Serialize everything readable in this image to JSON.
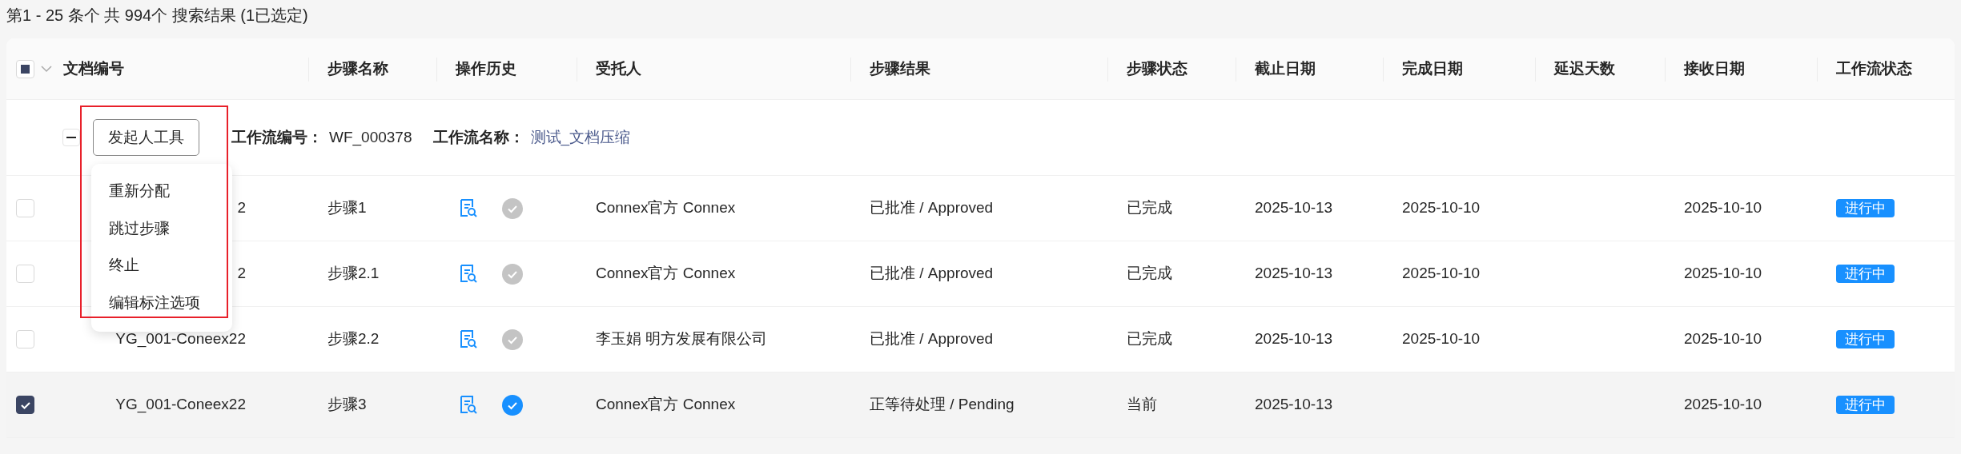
{
  "summary": "第1 - 25 条个 共 994个 搜索结果 (1已选定)",
  "header": {
    "select_all": {
      "indeterminate": true
    },
    "columns": [
      "文档编号",
      "步骤名称",
      "操作历史",
      "受托人",
      "步骤结果",
      "步骤状态",
      "截止日期",
      "完成日期",
      "延迟天数",
      "接收日期",
      "工作流状态"
    ]
  },
  "group": {
    "expanded": true,
    "tool_button": "发起人工具",
    "fields": [
      {
        "kind": "text",
        "label": "工作流编号：",
        "value": "WF_000378"
      },
      {
        "kind": "link",
        "label": "工作流名称：",
        "value": "测试_文档压缩"
      }
    ]
  },
  "menu": {
    "items": [
      "重新分配",
      "跳过步骤",
      "终止",
      "编辑标注选项"
    ]
  },
  "rows": [
    {
      "selected": false,
      "doc_number": "2",
      "step_name": "步骤1",
      "step_done": true,
      "assignee": "Connex官方 Connex",
      "result": "已批准 / Approved",
      "step_status": "已完成",
      "due_date": "2025-10-13",
      "completed_date": "2025-10-10",
      "received_date": "2025-10-10",
      "workflow_status": "进行中"
    },
    {
      "selected": false,
      "doc_number": "2",
      "step_name": "步骤2.1",
      "step_done": true,
      "assignee": "Connex官方 Connex",
      "result": "已批准 / Approved",
      "step_status": "已完成",
      "due_date": "2025-10-13",
      "completed_date": "2025-10-10",
      "received_date": "2025-10-10",
      "workflow_status": "进行中"
    },
    {
      "selected": false,
      "doc_number": "YG_001-Coneex22",
      "step_name": "步骤2.2",
      "step_done": true,
      "assignee": "李玉娟 明方发展有限公司",
      "result": "已批准 / Approved",
      "step_status": "已完成",
      "due_date": "2025-10-13",
      "completed_date": "2025-10-10",
      "received_date": "2025-10-10",
      "workflow_status": "进行中"
    },
    {
      "selected": true,
      "doc_number": "YG_001-Coneex22",
      "step_name": "步骤3",
      "step_done": false,
      "assignee": "Connex官方 Connex",
      "result": "正等待处理 / Pending",
      "step_status": "当前",
      "due_date": "2025-10-13",
      "received_date": "2025-10-10",
      "workflow_status": "进行中"
    }
  ]
}
